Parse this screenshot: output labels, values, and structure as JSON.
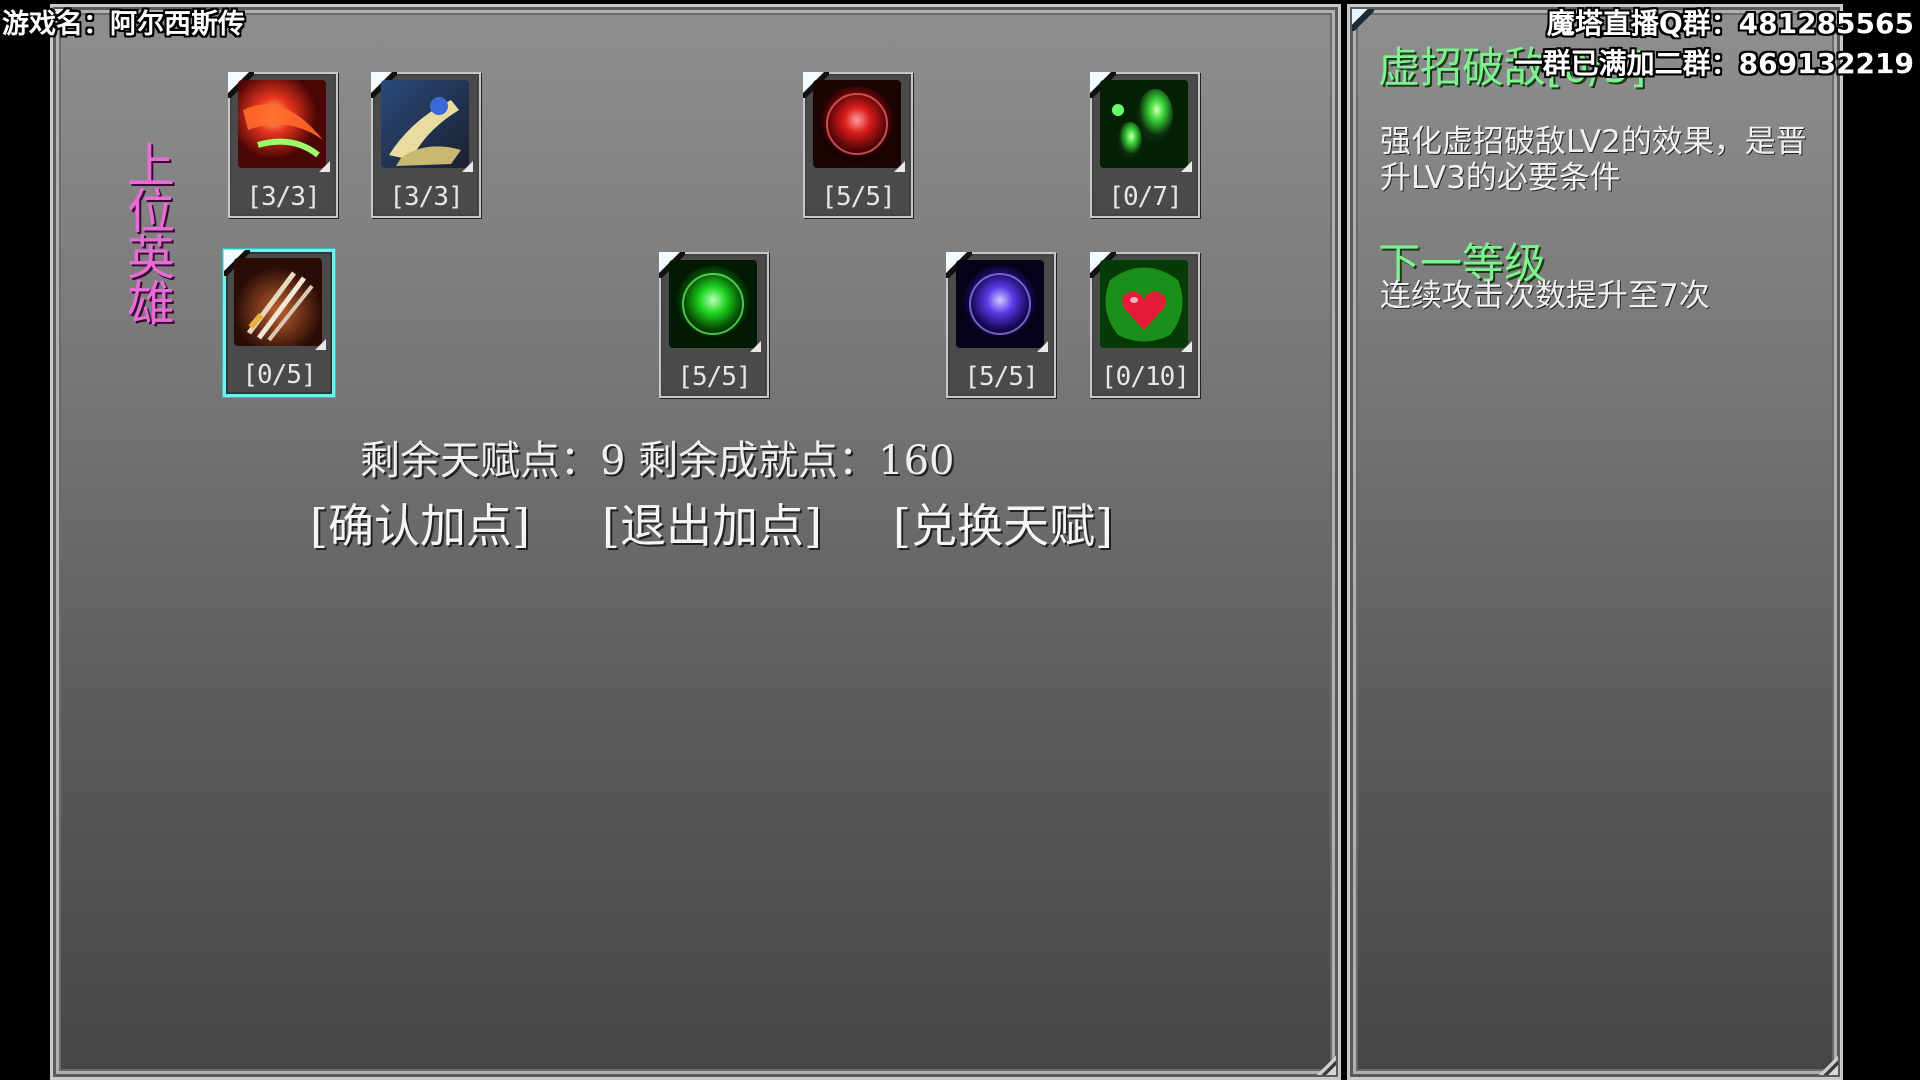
{
  "overlay": {
    "game_name": "游戏名：阿尔西斯传",
    "qq_group_1": "魔塔直播Q群：481285565",
    "qq_group_2": "一群已满加二群：869132219"
  },
  "talent_tree": {
    "class_label": "上位英雄",
    "skills": [
      {
        "id": "slash-red",
        "icon": "red-slash-icon",
        "count": "[3/3]",
        "selected": false
      },
      {
        "id": "gold-strike",
        "icon": "gold-strike-icon",
        "count": "[3/3]",
        "selected": false
      },
      {
        "id": "red-orb",
        "icon": "red-orb-icon",
        "count": "[5/5]",
        "selected": false
      },
      {
        "id": "green-spirit",
        "icon": "green-spirit-icon",
        "count": "[0/7]",
        "selected": false
      },
      {
        "id": "multi-sword",
        "icon": "multi-sword-icon",
        "count": "[0/5]",
        "selected": true
      },
      {
        "id": "green-orb",
        "icon": "green-orb-icon",
        "count": "[5/5]",
        "selected": false
      },
      {
        "id": "blue-orb",
        "icon": "blue-orb-icon",
        "count": "[5/5]",
        "selected": false
      },
      {
        "id": "heart-vine",
        "icon": "heart-vine-icon",
        "count": "[0/10]",
        "selected": false
      }
    ],
    "points_text": "剩余天赋点：9  剩余成就点：160",
    "buttons": {
      "confirm": "[确认加点]",
      "exit": "[退出加点]",
      "exchange": "[兑换天赋]"
    }
  },
  "info_panel": {
    "skill_title": "虚招破敌[0/5]",
    "description": "强化虚招破敌LV2的效果，是晋升LV3的必要条件",
    "next_level_title": "下一等级",
    "next_level_desc": "连续攻击次数提升至7次"
  },
  "colors": {
    "class_label": "#e86cd6",
    "highlight_green": "#7ef28e",
    "selected_border": "#6ff0ec"
  }
}
